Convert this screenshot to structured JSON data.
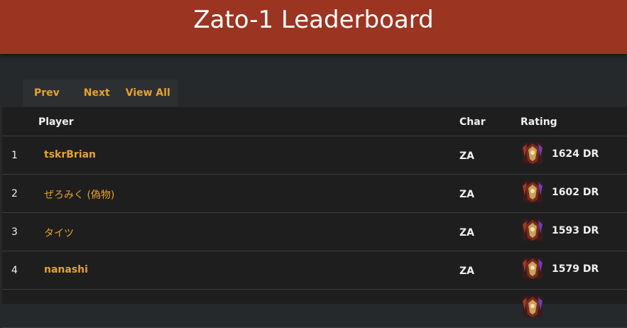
{
  "header": {
    "title": "Zato-1 Leaderboard"
  },
  "nav": {
    "prev": "Prev",
    "next": "Next",
    "view_all": "View All"
  },
  "table": {
    "columns": {
      "rank": "",
      "player": "Player",
      "char": "Char",
      "rating": "Rating"
    },
    "rows": [
      {
        "rank": "1",
        "player": "tskrBrian",
        "char": "ZA",
        "rating": "1624 DR",
        "rank_icon": "rank-badge-icon"
      },
      {
        "rank": "2",
        "player": "ぜろみく (偽物)",
        "char": "ZA",
        "rating": "1602 DR",
        "rank_icon": "rank-badge-icon"
      },
      {
        "rank": "3",
        "player": "タイツ",
        "char": "ZA",
        "rating": "1593 DR",
        "rank_icon": "rank-badge-icon"
      },
      {
        "rank": "4",
        "player": "nanashi",
        "char": "ZA",
        "rating": "1579 DR",
        "rank_icon": "rank-badge-icon"
      },
      {
        "rank": "",
        "player": "",
        "char": "",
        "rating": "",
        "rank_icon": "rank-badge-icon"
      }
    ]
  },
  "colors": {
    "header": "#9b3522",
    "accent": "#e8a22c",
    "background": "#25292c",
    "table": "#1e1e1e"
  }
}
